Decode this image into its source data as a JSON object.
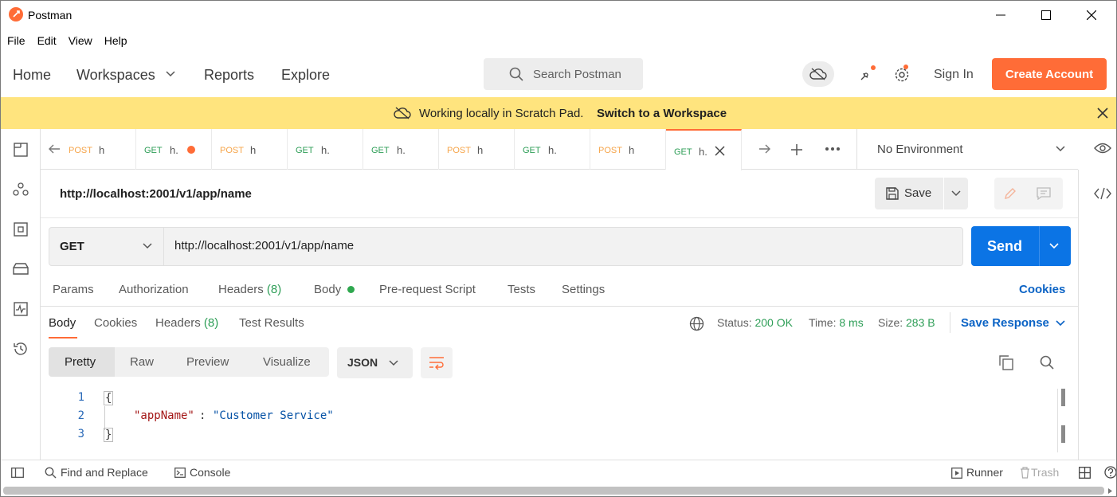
{
  "window": {
    "title": "Postman"
  },
  "menu": [
    "File",
    "Edit",
    "View",
    "Help"
  ],
  "nav": {
    "home": "Home",
    "workspaces": "Workspaces",
    "reports": "Reports",
    "explore": "Explore",
    "search_placeholder": "Search Postman",
    "sign_in": "Sign In",
    "create_account": "Create Account"
  },
  "banner": {
    "text": "Working locally in Scratch Pad.",
    "link": "Switch to a Workspace"
  },
  "tabs": [
    {
      "method": "POST",
      "name": "h"
    },
    {
      "method": "GET",
      "name": "h."
    },
    {
      "method": "POST",
      "name": "h"
    },
    {
      "method": "GET",
      "name": "h."
    },
    {
      "method": "GET",
      "name": "h."
    },
    {
      "method": "POST",
      "name": "h"
    },
    {
      "method": "GET",
      "name": "h."
    },
    {
      "method": "POST",
      "name": "h"
    },
    {
      "method": "GET",
      "name": "h."
    }
  ],
  "environment": "No Environment",
  "request": {
    "title": "http://localhost:2001/v1/app/name",
    "save": "Save",
    "method": "GET",
    "url": "http://localhost:2001/v1/app/name",
    "send": "Send",
    "tabs": {
      "params": "Params",
      "authorization": "Authorization",
      "headers": "Headers",
      "headers_count": "(8)",
      "body": "Body",
      "pre_request": "Pre-request Script",
      "tests": "Tests",
      "settings": "Settings"
    },
    "cookies": "Cookies"
  },
  "response": {
    "tabs": {
      "body": "Body",
      "cookies": "Cookies",
      "headers": "Headers",
      "headers_count": "(8)",
      "test_results": "Test Results"
    },
    "status_label": "Status:",
    "status_value": "200 OK",
    "time_label": "Time:",
    "time_value": "8 ms",
    "size_label": "Size:",
    "size_value": "283 B",
    "save_response": "Save Response",
    "formats": [
      "Pretty",
      "Raw",
      "Preview",
      "Visualize"
    ],
    "language": "JSON",
    "code": {
      "line_numbers": [
        "1",
        "2",
        "3"
      ],
      "open_brace": "{",
      "key": "\"appName\"",
      "colon": ":",
      "value": "\"Customer Service\"",
      "close_brace": "}"
    }
  },
  "statusbar": {
    "find_replace": "Find and Replace",
    "console": "Console",
    "runner": "Runner",
    "trash": "Trash"
  },
  "colors": {
    "accent": "#ff6c37",
    "primary": "#0b74e5",
    "banner": "#ffe47e",
    "get": "#2e9e57",
    "post": "#f6a54a"
  }
}
